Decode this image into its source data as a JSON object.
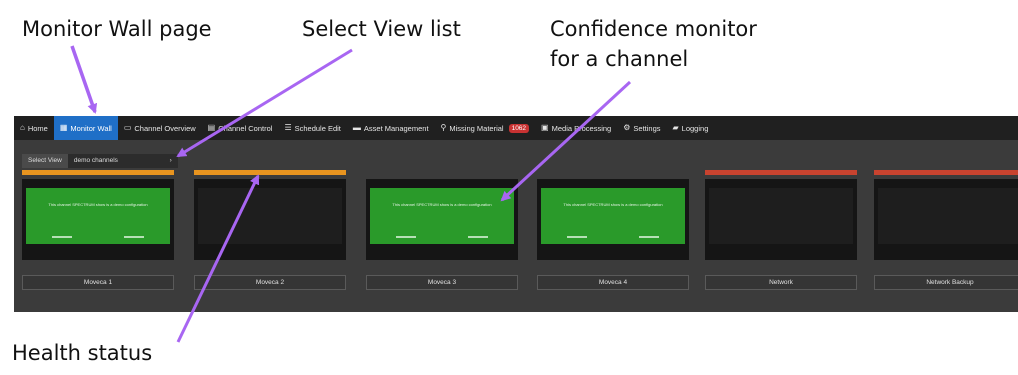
{
  "callouts": {
    "monitor_wall_page": "Monitor Wall page",
    "select_view_list": "Select View list",
    "confidence_line1": "Confidence monitor",
    "confidence_line2": "for a channel",
    "health_status": "Health status"
  },
  "nav": {
    "items": [
      {
        "icon": "home-icon",
        "glyph": "⌂",
        "label": "Home"
      },
      {
        "icon": "monitor-wall-icon",
        "glyph": "▦",
        "label": "Monitor Wall",
        "active": true
      },
      {
        "icon": "channel-overview-icon",
        "glyph": "▭",
        "label": "Channel Overview"
      },
      {
        "icon": "channel-control-icon",
        "glyph": "▤",
        "label": "Channel Control"
      },
      {
        "icon": "schedule-edit-icon",
        "glyph": "☰",
        "label": "Schedule Edit"
      },
      {
        "icon": "asset-management-icon",
        "glyph": "▬",
        "label": "Asset Management"
      },
      {
        "icon": "missing-material-icon",
        "glyph": "⚲",
        "label": "Missing Material",
        "badge": "1062"
      },
      {
        "icon": "media-processing-icon",
        "glyph": "▣",
        "label": "Media Processing"
      },
      {
        "icon": "settings-icon",
        "glyph": "⚙",
        "label": "Settings"
      },
      {
        "icon": "logging-icon",
        "glyph": "▰",
        "label": "Logging"
      }
    ]
  },
  "select_view": {
    "label": "Select View",
    "value": "demo channels",
    "arrow_icon": "chevron-right-icon"
  },
  "status_colors": {
    "warning": "#e8941f",
    "error": "#c8432f"
  },
  "monitors": [
    {
      "name": "Moveca 1",
      "status": "warning",
      "screen": "green",
      "text": "This channel SPECTRUM show is a demo configuration"
    },
    {
      "name": "Moveca 2",
      "status": "warning",
      "screen": "dark",
      "text": ""
    },
    {
      "name": "Moveca 3",
      "status": "none",
      "screen": "green",
      "text": "This channel SPECTRUM show is a demo configuration"
    },
    {
      "name": "Moveca 4",
      "status": "none",
      "screen": "green",
      "text": "This channel SPECTRUM show is a demo configuration"
    },
    {
      "name": "Network",
      "status": "error",
      "screen": "dark",
      "text": ""
    },
    {
      "name": "Network Backup",
      "status": "error",
      "screen": "dark",
      "text": ""
    }
  ]
}
